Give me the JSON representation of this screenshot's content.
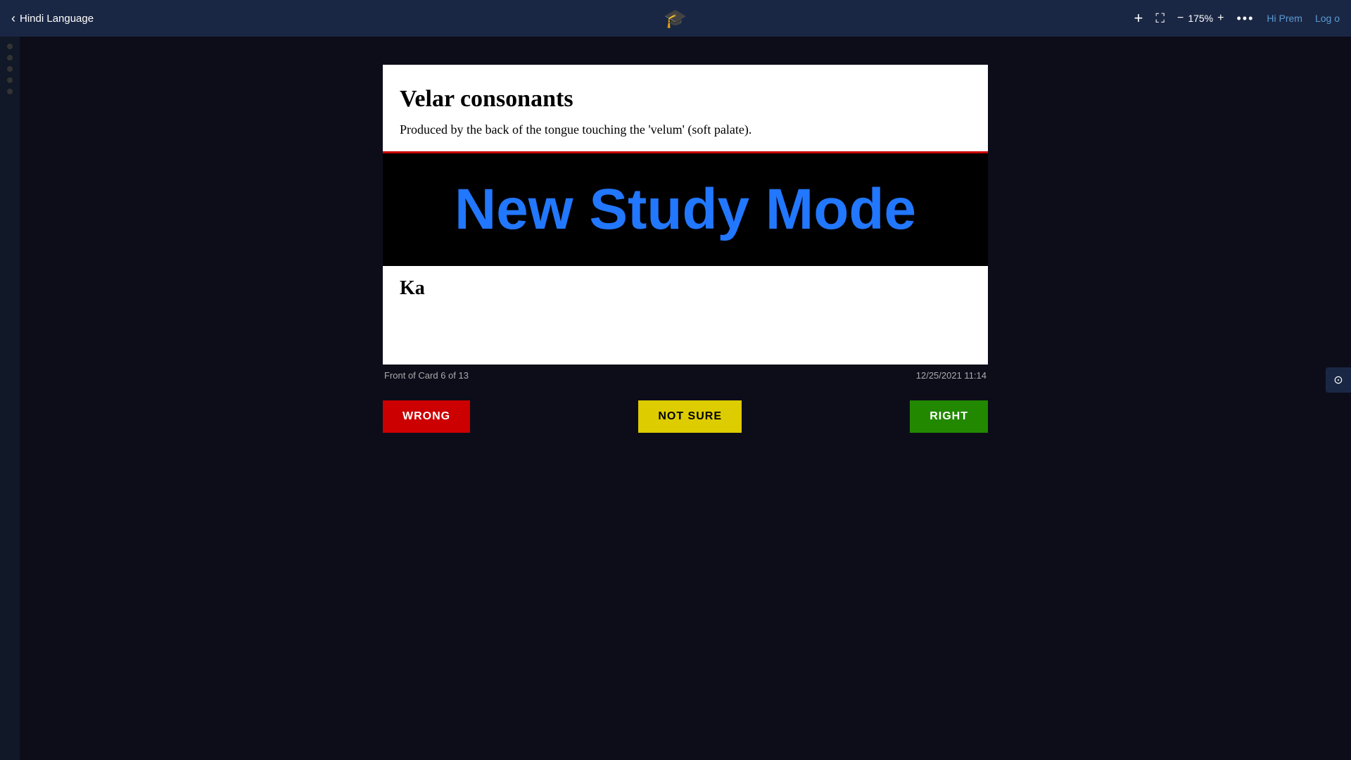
{
  "topbar": {
    "back_label": "Hindi Language",
    "graduation_icon": "🎓",
    "add_icon": "+",
    "expand_icon": "⛶",
    "zoom_minus": "−",
    "zoom_level": "175%",
    "zoom_plus": "+",
    "more_icon": "•••",
    "user_greeting": "Hi Prem",
    "logout_label": "Log o"
  },
  "card": {
    "heading": "Velar consonants",
    "subtitle": "Produced by the back of the tongue touching the 'velum' (soft palate).",
    "banner_text": "New Study Mode",
    "bottom_text": "Ka",
    "position": "Front of Card 6 of 13",
    "timestamp": "12/25/2021 11:14"
  },
  "buttons": {
    "wrong_label": "WRONG",
    "not_sure_label": "NOT SURE",
    "right_label": "RIGHT"
  }
}
